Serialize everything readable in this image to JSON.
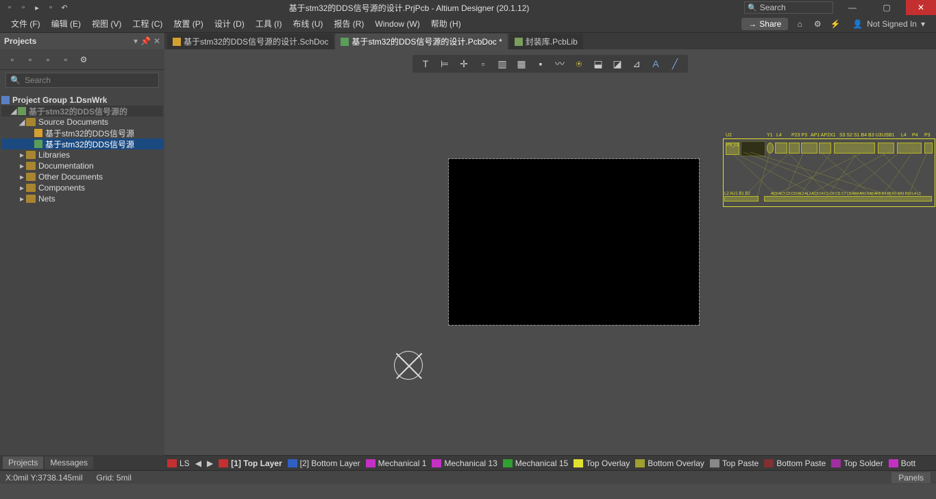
{
  "titlebar": {
    "title": "基于stm32的DDS信号源的设计.PrjPcb - Altium Designer (20.1.12)",
    "search_placeholder": "Search"
  },
  "menubar": {
    "items": [
      "文件 (F)",
      "编辑 (E)",
      "视图 (V)",
      "工程 (C)",
      "放置 (P)",
      "设计 (D)",
      "工具 (I)",
      "布线 (U)",
      "报告 (R)",
      "Window (W)",
      "帮助 (H)"
    ],
    "share": "Share",
    "signin": "Not Signed In"
  },
  "projects_panel": {
    "title": "Projects",
    "search_placeholder": "Search",
    "tree": {
      "root": "Project Group 1.DsnWrk",
      "project": "基于stm32的DDS信号源的",
      "source_docs": "Source Documents",
      "doc1": "基于stm32的DDS信号源",
      "doc2": "基于stm32的DDS信号源",
      "libraries": "Libraries",
      "documentation": "Documentation",
      "other_docs": "Other Documents",
      "components": "Components",
      "nets": "Nets"
    }
  },
  "tabs": {
    "t1": "基于stm32的DDS信号源的设计.SchDoc",
    "t2": "基于stm32的DDS信号源的设计.PcbDoc *",
    "t3": "封装库.PcbLib"
  },
  "components": {
    "labels": [
      "U2",
      "Y1",
      "L4",
      "P23 P3",
      "AP1 AP2",
      "X1",
      "S3 S2 S1 B4 B3 U3",
      "USB1",
      "L4",
      "P4",
      "P3"
    ],
    "bottom": "L2 AU1 B1 B2",
    "bottom2": "AC9 AC7 C2 C10 AL2 AL1 AC3 C4 C1 C9 C11 C7 C8 AR4 AR1 RA5 AR6 R4 R5 R1 RA1 R10 L4 L3"
  },
  "layers": {
    "ls": "LS",
    "items": [
      {
        "name": "[1] Top Layer",
        "color": "#c43030",
        "bold": true
      },
      {
        "name": "[2] Bottom Layer",
        "color": "#3060c4"
      },
      {
        "name": "Mechanical 1",
        "color": "#c430c4"
      },
      {
        "name": "Mechanical 13",
        "color": "#c430c4"
      },
      {
        "name": "Mechanical 15",
        "color": "#30a030"
      },
      {
        "name": "Top Overlay",
        "color": "#e0e030"
      },
      {
        "name": "Bottom Overlay",
        "color": "#a0a030"
      },
      {
        "name": "Top Paste",
        "color": "#888"
      },
      {
        "name": "Bottom Paste",
        "color": "#803030"
      },
      {
        "name": "Top Solder",
        "color": "#a030a0"
      },
      {
        "name": "Bott",
        "color": "#c430c4"
      }
    ]
  },
  "status_tabs": {
    "t1": "Projects",
    "t2": "Messages"
  },
  "statusbar": {
    "coords": "X:0mil Y:3738.145mil",
    "grid": "Grid: 5mil",
    "panels": "Panels"
  }
}
